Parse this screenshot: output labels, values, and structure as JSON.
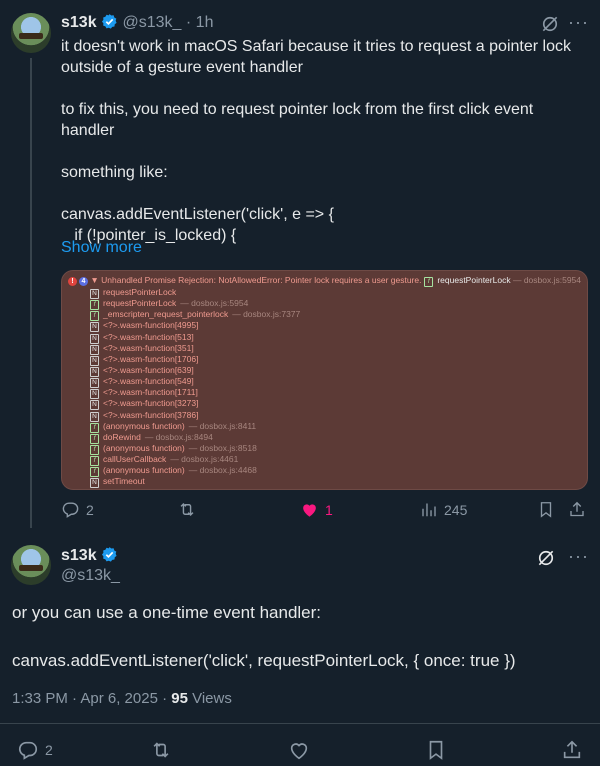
{
  "tweet1": {
    "name": "s13k",
    "handle": "@s13k_",
    "time": "· 1h",
    "body": "it doesn't work in macOS Safari because it tries to request a pointer lock\noutside of a gesture event handler\n\nto fix this, you need to request pointer lock from the first click event\nhandler\n\nsomething like:\n\ncanvas.addEventListener('click', e => {\n   if (!pointer_is_locked) {",
    "show_more": "Show more",
    "console": {
      "error_count": "!",
      "repeat_count": "4",
      "message": "▼ Unhandled Promise Rejection: NotAllowedError: Pointer lock requires a user gesture.",
      "origin_fn": "requestPointerLock",
      "origin_loc": "— dosbox.js:5954",
      "frames": [
        {
          "type": "N",
          "fn": "requestPointerLock",
          "loc": ""
        },
        {
          "type": "f",
          "fn": "requestPointerLock",
          "loc": "— dosbox.js:5954"
        },
        {
          "type": "f",
          "fn": "_emscripten_request_pointerlock",
          "loc": "— dosbox.js:7377"
        },
        {
          "type": "N",
          "fn": "<?>.wasm-function[4995]",
          "loc": ""
        },
        {
          "type": "N",
          "fn": "<?>.wasm-function[513]",
          "loc": ""
        },
        {
          "type": "N",
          "fn": "<?>.wasm-function[351]",
          "loc": ""
        },
        {
          "type": "N",
          "fn": "<?>.wasm-function[1706]",
          "loc": ""
        },
        {
          "type": "N",
          "fn": "<?>.wasm-function[639]",
          "loc": ""
        },
        {
          "type": "N",
          "fn": "<?>.wasm-function[549]",
          "loc": ""
        },
        {
          "type": "N",
          "fn": "<?>.wasm-function[1711]",
          "loc": ""
        },
        {
          "type": "N",
          "fn": "<?>.wasm-function[3273]",
          "loc": ""
        },
        {
          "type": "N",
          "fn": "<?>.wasm-function[3786]",
          "loc": ""
        },
        {
          "type": "f",
          "fn": "(anonymous function)",
          "loc": "— dosbox.js:8411"
        },
        {
          "type": "f",
          "fn": "doRewind",
          "loc": "— dosbox.js:8494"
        },
        {
          "type": "f",
          "fn": "(anonymous function)",
          "loc": "— dosbox.js:8518"
        },
        {
          "type": "f",
          "fn": "callUserCallback",
          "loc": "— dosbox.js:4461"
        },
        {
          "type": "f",
          "fn": "(anonymous function)",
          "loc": "— dosbox.js:4468"
        },
        {
          "type": "N",
          "fn": "setTimeout",
          "loc": ""
        }
      ]
    },
    "actions": {
      "replies": "2",
      "likes": "1",
      "views": "245"
    }
  },
  "tweet2": {
    "name": "s13k",
    "handle": "@s13k_",
    "body": "or you can use a one-time event handler:\n\ncanvas.addEventListener('click', requestPointerLock, { once: true })",
    "timestamp": "1:33 PM · Apr 6, 2025 · ",
    "views_count": "95",
    "views_label": " Views",
    "actions": {
      "replies": "2"
    }
  },
  "colors": {
    "background": "#15202b",
    "accent": "#1d9bf0",
    "like": "#f91880",
    "muted": "#8b98a5"
  },
  "icons": [
    "grok-icon",
    "more-icon",
    "reply-icon",
    "retweet-icon",
    "like-icon",
    "views-icon",
    "bookmark-icon",
    "share-icon",
    "verified-icon"
  ]
}
